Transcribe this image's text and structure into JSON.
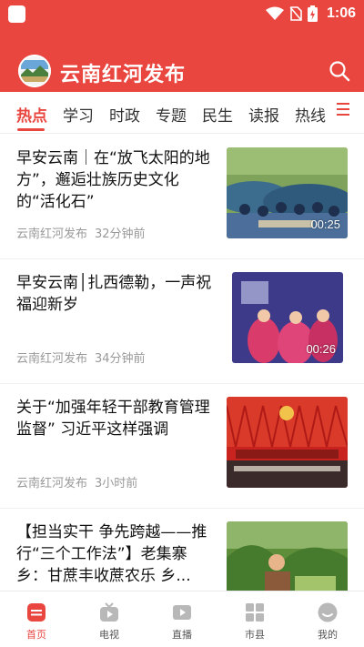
{
  "status_bar": {
    "time": "1:06",
    "icons": [
      "app-square-icon",
      "wifi-icon",
      "no-sim-icon",
      "battery-charging-icon"
    ]
  },
  "header": {
    "app_title": "云南红河发布",
    "logo_icon": "honghe-logo-icon",
    "search_icon": "search-icon",
    "background_color": "#e94640"
  },
  "tabs": {
    "items": [
      {
        "label": "热点",
        "active": true
      },
      {
        "label": "学习"
      },
      {
        "label": "时政"
      },
      {
        "label": "专题"
      },
      {
        "label": "民生"
      },
      {
        "label": "读报"
      },
      {
        "label": "热线"
      }
    ],
    "menu_icon": "hamburger-menu-icon",
    "accent_color": "#e94640"
  },
  "feed": {
    "items": [
      {
        "title": "早安云南｜在“放飞太阳的地方”，邂逅壮族历史文化的“活化石”",
        "source": "云南红河发布",
        "time": "32分钟前",
        "duration": "00:25"
      },
      {
        "title": "早安云南│扎西德勒，一声祝福迎新岁",
        "source": "云南红河发布",
        "time": "34分钟前",
        "duration": "00:26"
      },
      {
        "title": "关于“加强年轻干部教育管理监督” 习近平这样强调",
        "source": "云南红河发布",
        "time": "3小时前"
      },
      {
        "title": "【担当实干 争先跨越——推行“三个工作法”】老集寨乡：甘蔗丰收蔗农乐 乡..."
      }
    ]
  },
  "bottom_nav": {
    "items": [
      {
        "label": "首页",
        "icon": "home-icon",
        "active": true
      },
      {
        "label": "电视",
        "icon": "tv-icon"
      },
      {
        "label": "直播",
        "icon": "live-video-icon"
      },
      {
        "label": "市县",
        "icon": "grid-icon"
      },
      {
        "label": "我的",
        "icon": "profile-icon"
      }
    ]
  }
}
